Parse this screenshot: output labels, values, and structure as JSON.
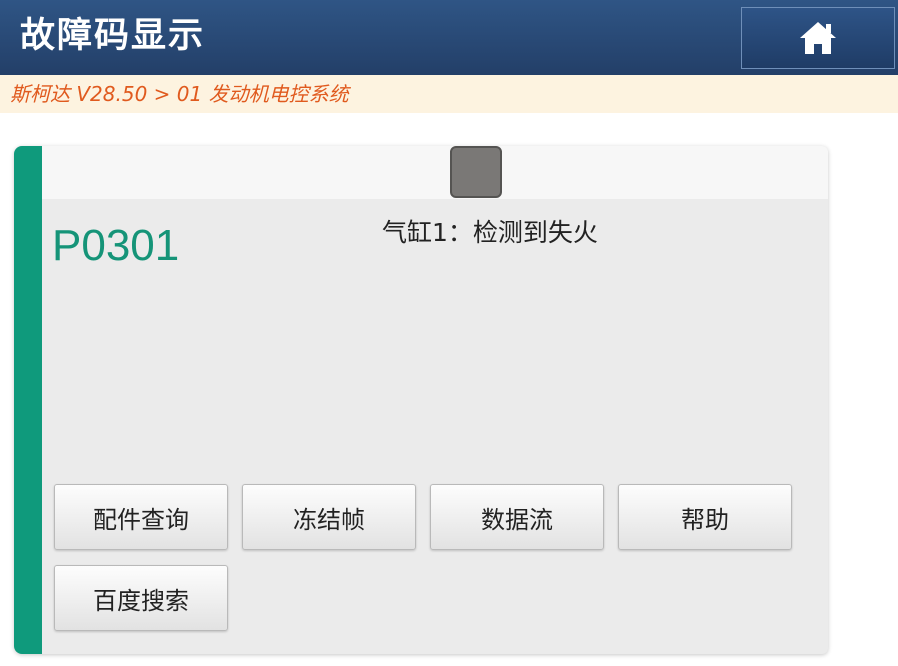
{
  "header": {
    "title": "故障码显示",
    "home_icon": "home-icon"
  },
  "breadcrumb": "斯柯达 V28.50 > 01 发动机电控系统",
  "fault": {
    "code": "P0301",
    "description": "气缸1：检测到失火"
  },
  "buttons": {
    "parts_query": "配件查询",
    "freeze_frame": "冻结帧",
    "data_stream": "数据流",
    "help": "帮助",
    "baidu_search": "百度搜索"
  },
  "colors": {
    "header": "#2a4b78",
    "accent": "#0f9a7c",
    "breadcrumb_text": "#e05a1e"
  }
}
